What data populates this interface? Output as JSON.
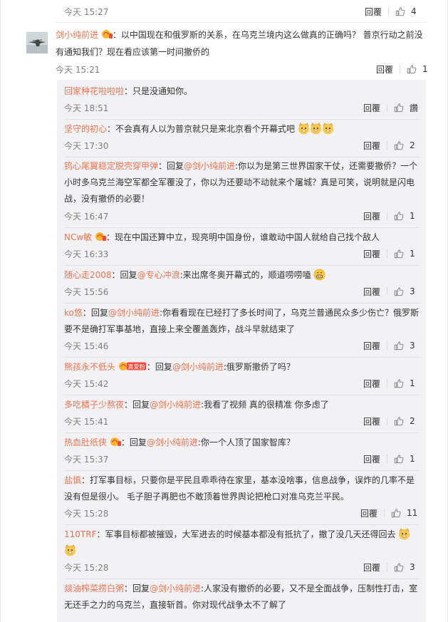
{
  "top_comment": {
    "time": "今天 15:27",
    "reply": "回覆",
    "likes": "4"
  },
  "main_comment": {
    "user": "剑小纯前进",
    "text": "：以中国现在和俄罗斯的关系，在乌克兰境内这么做真的正确吗？ 普京行动之前没有通知我们？现在看应该第一时间撤侨的",
    "time": "今天 15:21",
    "reply": "回覆",
    "likes": "1"
  },
  "replies": [
    {
      "user": "回家种花啦啦啦",
      "text": "：只是没通知你。",
      "time": "今天 18:51",
      "reply": "回覆",
      "likes": "讚"
    },
    {
      "user": "坚守的初心",
      "text": "：不会真有人以为普京就只是来北京看个开幕式吧",
      "time": "今天 17:30",
      "reply": "回覆",
      "likes": "2"
    },
    {
      "user": "钨心尾翼稳定脱壳穿甲弹",
      "pre": "：回复",
      "at": "@剑小纯前进",
      "text": ":你以为是第三世界国家干仗，还需要撤侨？一个小时多乌克兰海空军都全军覆没了，你以为还要动不动就来个屠城？真是可笑，说明就是闪电战，没有撤侨的必要！",
      "time": "今天 16:47",
      "reply": "回覆",
      "likes": "1"
    },
    {
      "user": "NCw敏",
      "text": "：现在中国还算中立，现亮明中国身份，谁敢动中国人就给自己找个敌人",
      "time": "今天 16:33",
      "reply": "回覆",
      "likes": "1"
    },
    {
      "user": "随心走2008",
      "pre": "：回复",
      "at": "@专心冲浪",
      "text": ":来出席冬奥开幕式的，顺道唠唠嗑",
      "time": "今天 15:56",
      "reply": "回覆",
      "likes": "3"
    },
    {
      "user": "ko悠",
      "pre": "：回复",
      "at": "@剑小纯前进",
      "text": ":你看看现在已经打了多长时间了，乌克兰普通民众多少伤亡？俄罗斯要不是确打军事基地，直接上来全覆盖轰炸，战斗早就结束了",
      "time": "今天 15:46",
      "reply": "回覆",
      "likes": "3"
    },
    {
      "user": "熊孩永不低头",
      "badge_text": "真爱粉",
      "pre": "：回复",
      "at": "@剑小纯前进",
      "text": ":俄罗斯撤侨了吗？",
      "time": "今天 15:42",
      "reply": "回覆",
      "likes": "1"
    },
    {
      "user": "多吃橘子少熬夜",
      "pre": "：回复",
      "at": "@剑小纯前进",
      "text": ":我看了视频 真的很精准 你多虑了",
      "time": "今天 15:41",
      "reply": "回覆",
      "likes": "2"
    },
    {
      "user": "热血肚纸侠",
      "pre": "：回复",
      "at": "@剑小纯前进",
      "text": ":你一个人顶了国家智库？",
      "time": "今天 15:37",
      "reply": "回覆",
      "likes": "1"
    },
    {
      "user": "盐慎",
      "text": "：打军事目标，只要你是平民且乖乖待在家里，基本没啥事，信息战争，误炸的几率不是没有但是很小。 毛子胆子再肥也不敢顶着世界舆论把枪口对准乌克兰平民。",
      "time": "今天 15:28",
      "reply": "回覆",
      "likes": "11"
    },
    {
      "user": "110TRF",
      "text": "：军事目标都被摧毁，大军进去的时候基本都没有抵抗了，撤了没几天还得回去",
      "time": "今天 15:28",
      "reply": "回覆",
      "likes": "3"
    },
    {
      "user": "燚油榨菜捞白粥",
      "pre": "：回复",
      "at": "@剑小纯前进",
      "text": ":人家没有撤侨的必要，又不是全面战争，压制性打击，室无还手之力的乌克兰，直接斩首。你对现代战争太不了解了"
    }
  ],
  "colors": {
    "username": "#eb7350",
    "text": "#333333",
    "meta": "#808080",
    "panel": "#f2f2f5"
  },
  "icons": {
    "like": "thumbs-up-icon",
    "emoji": "doge-emoji-icon",
    "badge": "fan-badge-icon"
  }
}
